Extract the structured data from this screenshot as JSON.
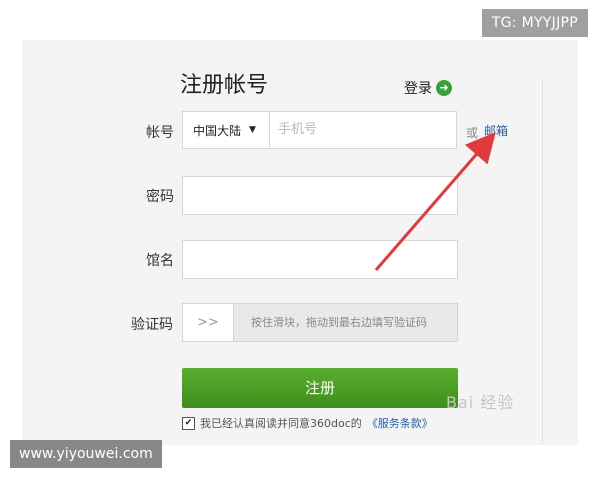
{
  "badges": {
    "tg": "TG: MYYJJPP",
    "site": "www.yiyouwei.com"
  },
  "form": {
    "title": "注册帐号",
    "login_label": "登录",
    "login_icon": "arrow-right-circle-icon",
    "account_label": "帐号",
    "region": "中国大陆",
    "phone_placeholder": "手机号",
    "or_text": "或",
    "email_link": "邮箱",
    "password_label": "密码",
    "nickname_label": "馆名",
    "captcha_label": "验证码",
    "captcha_handle": ">>",
    "captcha_hint": "按住滑块，拖动到最右边填写验证码",
    "register_button": "注册",
    "agree_text": "我已经认真阅读并同意360doc的",
    "terms_link": "《服务条款》"
  },
  "watermark": {
    "text": "Bai 经验"
  },
  "colors": {
    "accent_green": "#4a9e25",
    "link_blue": "#2a5ea8",
    "annotation_red": "#e03a3a"
  }
}
